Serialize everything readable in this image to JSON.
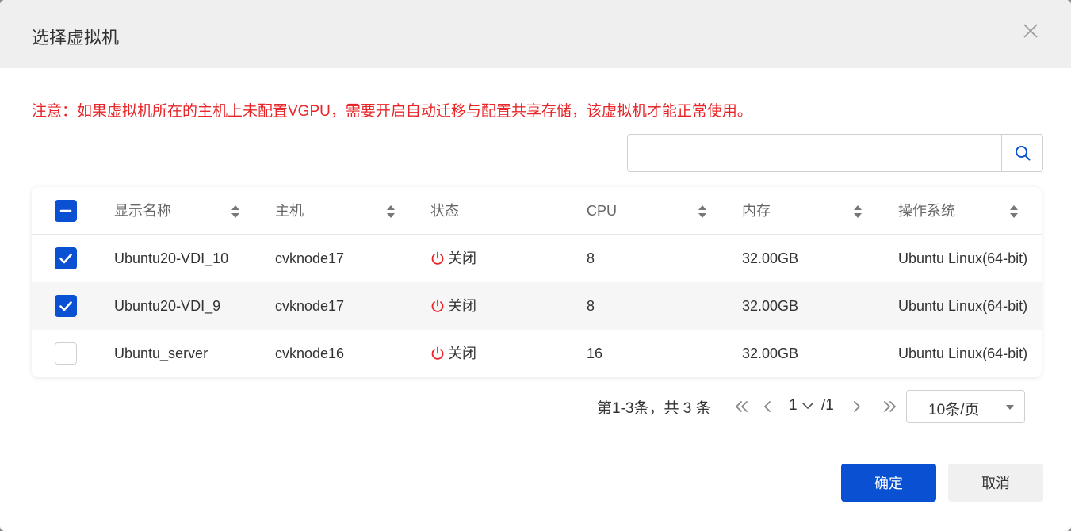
{
  "dialog": {
    "title": "选择虚拟机",
    "notice": "注意：如果虚拟机所在的主机上未配置VGPU，需要开启自动迁移与配置共享存储，该虚拟机才能正常使用。",
    "search": {
      "value": "",
      "placeholder": ""
    }
  },
  "table": {
    "headers": {
      "name": "显示名称",
      "host": "主机",
      "status": "状态",
      "cpu": "CPU",
      "memory": "内存",
      "os": "操作系统"
    },
    "select_all_state": "indeterminate",
    "rows": [
      {
        "checked": true,
        "name": "Ubuntu20-VDI_10",
        "host": "cvknode17",
        "status": "关闭",
        "cpu": "8",
        "memory": "32.00GB",
        "os": "Ubuntu Linux(64-bit)"
      },
      {
        "checked": true,
        "name": "Ubuntu20-VDI_9",
        "host": "cvknode17",
        "status": "关闭",
        "cpu": "8",
        "memory": "32.00GB",
        "os": "Ubuntu Linux(64-bit)"
      },
      {
        "checked": false,
        "name": "Ubuntu_server",
        "host": "cvknode16",
        "status": "关闭",
        "cpu": "16",
        "memory": "32.00GB",
        "os": "Ubuntu Linux(64-bit)"
      }
    ]
  },
  "pagination": {
    "summary": "第1-3条，共 3 条",
    "current_page": "1",
    "total_pages": "/1",
    "page_size": "10条/页"
  },
  "footer": {
    "ok_label": "确定",
    "cancel_label": "取消"
  },
  "colors": {
    "primary": "#0a50d2",
    "notice": "#e8262a",
    "status_off": "#e8262a"
  },
  "icons": {
    "close": "close-icon",
    "search": "search-icon",
    "sort": "sort-icon",
    "power": "power-icon",
    "first_page": "double-chevron-left-icon",
    "prev_page": "chevron-left-icon",
    "next_page": "chevron-right-icon",
    "last_page": "double-chevron-right-icon",
    "page_dropdown": "chevron-down-icon",
    "page_size_dropdown": "caret-down-icon"
  }
}
